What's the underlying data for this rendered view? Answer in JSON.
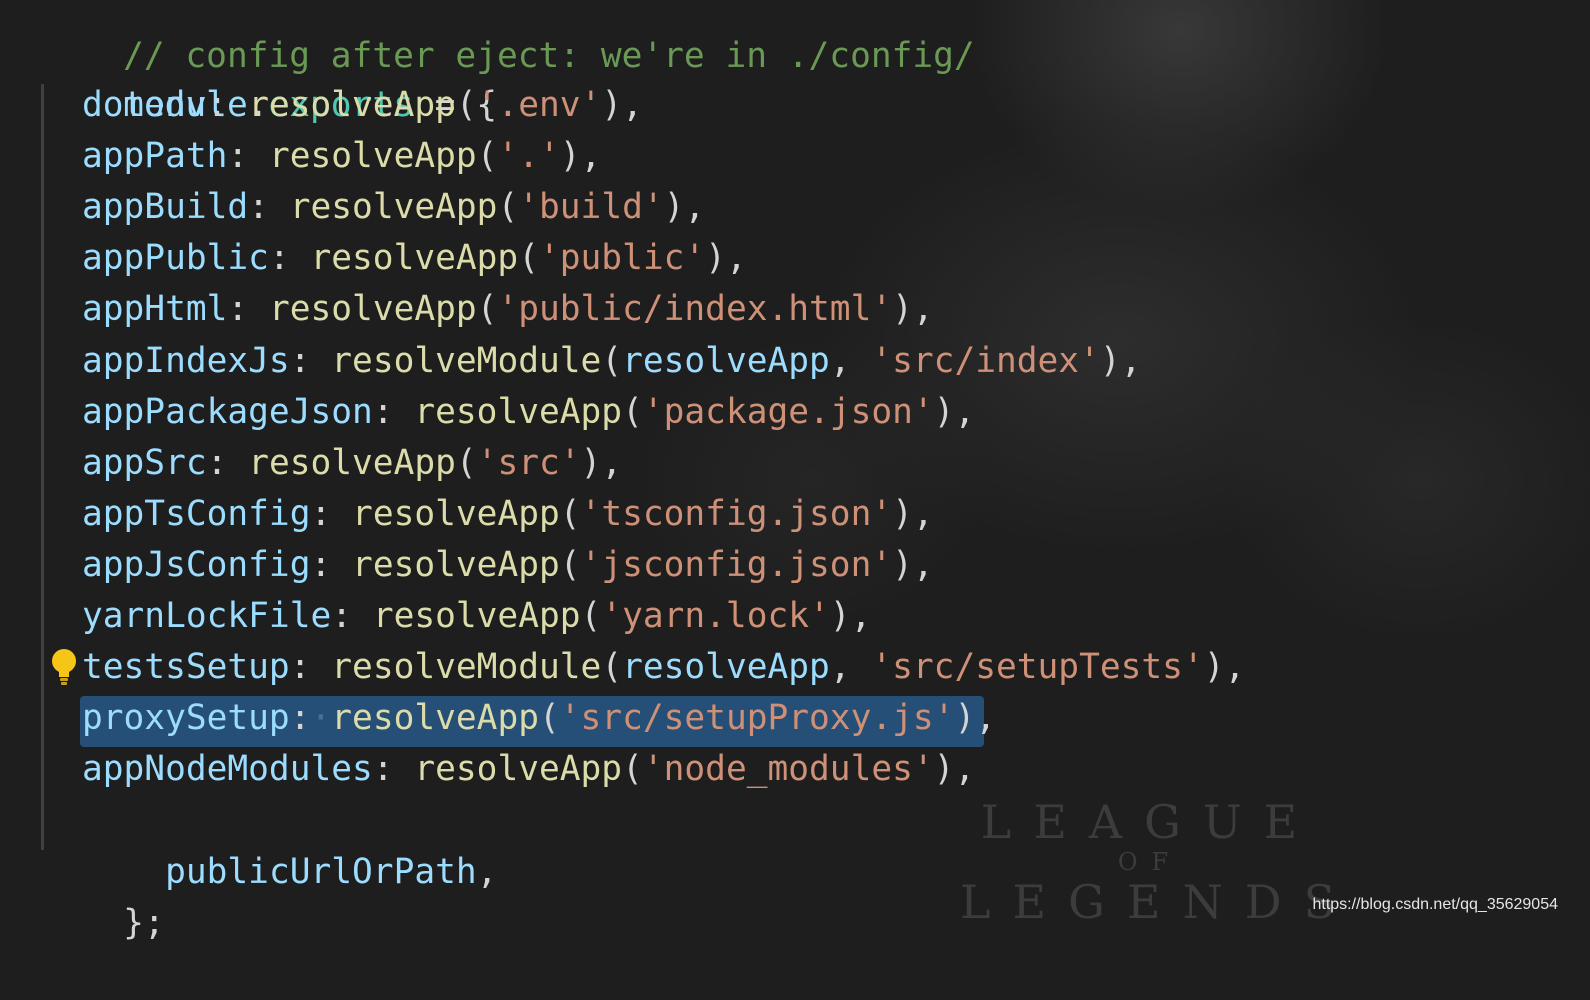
{
  "editor": {
    "comment_line": "// config after eject: we're in ./config/",
    "module_word": "module",
    "dot": ".",
    "exports_word": "exports",
    "assign": " = {",
    "closing": "};",
    "entries": [
      {
        "key": "dotenv",
        "fn": "resolveApp",
        "arg": "",
        "str": "'.env'"
      },
      {
        "key": "appPath",
        "fn": "resolveApp",
        "arg": "",
        "str": "'.'"
      },
      {
        "key": "appBuild",
        "fn": "resolveApp",
        "arg": "",
        "str": "'build'"
      },
      {
        "key": "appPublic",
        "fn": "resolveApp",
        "arg": "",
        "str": "'public'"
      },
      {
        "key": "appHtml",
        "fn": "resolveApp",
        "arg": "",
        "str": "'public/index.html'"
      },
      {
        "key": "appIndexJs",
        "fn": "resolveModule",
        "arg": "resolveApp",
        "str": "'src/index'"
      },
      {
        "key": "appPackageJson",
        "fn": "resolveApp",
        "arg": "",
        "str": "'package.json'"
      },
      {
        "key": "appSrc",
        "fn": "resolveApp",
        "arg": "",
        "str": "'src'"
      },
      {
        "key": "appTsConfig",
        "fn": "resolveApp",
        "arg": "",
        "str": "'tsconfig.json'"
      },
      {
        "key": "appJsConfig",
        "fn": "resolveApp",
        "arg": "",
        "str": "'jsconfig.json'"
      },
      {
        "key": "yarnLockFile",
        "fn": "resolveApp",
        "arg": "",
        "str": "'yarn.lock'"
      },
      {
        "key": "testsSetup",
        "fn": "resolveModule",
        "arg": "resolveApp",
        "str": "'src/setupTests'"
      },
      {
        "key": "proxySetup",
        "fn": "resolveApp",
        "arg": "",
        "str": "'src/setupProxy.js'"
      },
      {
        "key": "appNodeModules",
        "fn": "resolveApp",
        "arg": "",
        "str": "'node_modules'"
      }
    ],
    "shorthand_entry": "publicUrlOrPath",
    "selected_line_key": "proxySetup"
  },
  "background": {
    "watermark_top": "LEAGUE",
    "watermark_middle": "OF",
    "watermark_bottom": "LEGENDS"
  },
  "footer": {
    "url": "https://blog.csdn.net/qq_35629054"
  },
  "colors": {
    "background": "#1e1e1e",
    "selection": "#264f78",
    "key": "#9cdcfe",
    "function": "#dcdcaa",
    "string": "#ce9178",
    "comment": "#6a9955",
    "lightbulb": "#f5c518"
  },
  "icons": {
    "lightbulb": "lightbulb-icon"
  }
}
